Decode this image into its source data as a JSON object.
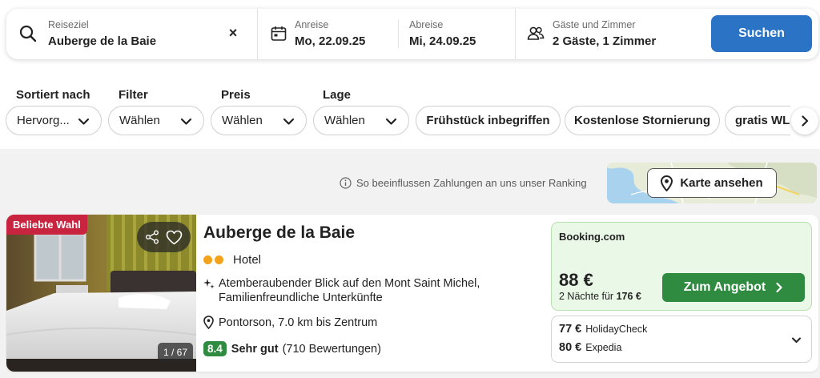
{
  "search": {
    "destination": {
      "label": "Reiseziel",
      "value": "Auberge de la Baie",
      "clear": "×"
    },
    "checkin": {
      "label": "Anreise",
      "value": "Mo, 22.09.25"
    },
    "checkout": {
      "label": "Abreise",
      "value": "Mi, 24.09.25"
    },
    "guests": {
      "label": "Gäste und Zimmer",
      "value": "2 Gäste, 1 Zimmer"
    },
    "submit": "Suchen"
  },
  "filters": {
    "sort": {
      "label": "Sortiert nach",
      "value": "Hervorg..."
    },
    "filter": {
      "label": "Filter",
      "value": "Wählen"
    },
    "price": {
      "label": "Preis",
      "value": "Wählen"
    },
    "location": {
      "label": "Lage",
      "value": "Wählen"
    },
    "chips": [
      "Frühstück inbegriffen",
      "Kostenlose Stornierung",
      "gratis WL"
    ]
  },
  "results": {
    "ranking_note": "So beeinflussen Zahlungen an uns unser Ranking",
    "map_button": "Karte ansehen"
  },
  "hotel": {
    "badge": "Beliebte Wahl",
    "photo_counter": "1 / 67",
    "name": "Auberge de la Baie",
    "type": "Hotel",
    "stars": 2,
    "highlight": "Atemberaubender Blick auf den Mont Saint Michel, Familienfreundliche Unterkünfte",
    "location": "Pontorson, 7.0 km bis Zentrum",
    "rating_score": "8.4",
    "rating_label": "Sehr gut",
    "rating_count": "(710 Bewertungen)"
  },
  "offer": {
    "provider": "Booking.com",
    "price": "88 €",
    "nights_text": "2 Nächte für",
    "nights_total": "176 €",
    "cta": "Zum Angebot"
  },
  "alternatives": [
    {
      "price": "77 €",
      "provider": "HolidayCheck"
    },
    {
      "price": "80 €",
      "provider": "Expedia"
    }
  ],
  "colors": {
    "search_button": "#2a73c5",
    "deal_button": "#2e8b3f",
    "badge": "#c8243f",
    "offer_bg": "#eaf8e7",
    "star_dots": "#f2a21b"
  },
  "icons": {
    "destination": "search-icon",
    "dates": "calendar-icon",
    "guests": "people-icon",
    "map": "map-pin-icon",
    "share": "share-icon",
    "favorite": "heart-icon",
    "highlight": "sparkle-icon",
    "location": "location-pin-icon",
    "ranking": "info-icon"
  }
}
